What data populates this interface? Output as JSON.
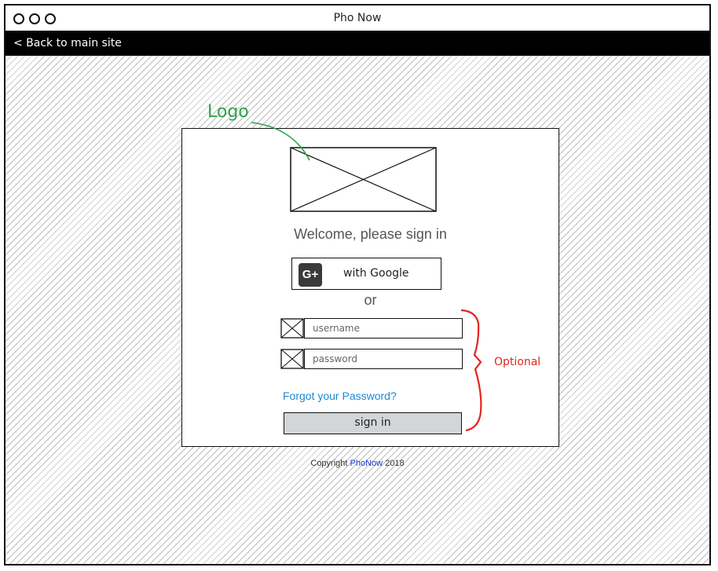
{
  "window": {
    "title": "Pho Now"
  },
  "nav": {
    "back_label": "< Back to main site"
  },
  "login": {
    "welcome": "Welcome, please sign in",
    "google_icon": "G+",
    "google_label": "with Google",
    "or": "or",
    "username_placeholder": "username",
    "password_placeholder": "password",
    "forgot": "Forgot your Password?",
    "signin": "sign in"
  },
  "footer": {
    "copyright_prefix": "Copyright ",
    "brand": "PhoNow",
    "year": " 2018"
  },
  "annotations": {
    "logo": "Logo",
    "optional": "Optional"
  },
  "colors": {
    "annotation_green": "#2fa24a",
    "annotation_red": "#e8231f",
    "link_blue": "#1e88d2",
    "brand_blue": "#1a3acd"
  },
  "icons": {
    "google": "google-plus-icon",
    "username": "image-placeholder-icon",
    "password": "image-placeholder-icon",
    "logo": "image-placeholder-icon"
  }
}
